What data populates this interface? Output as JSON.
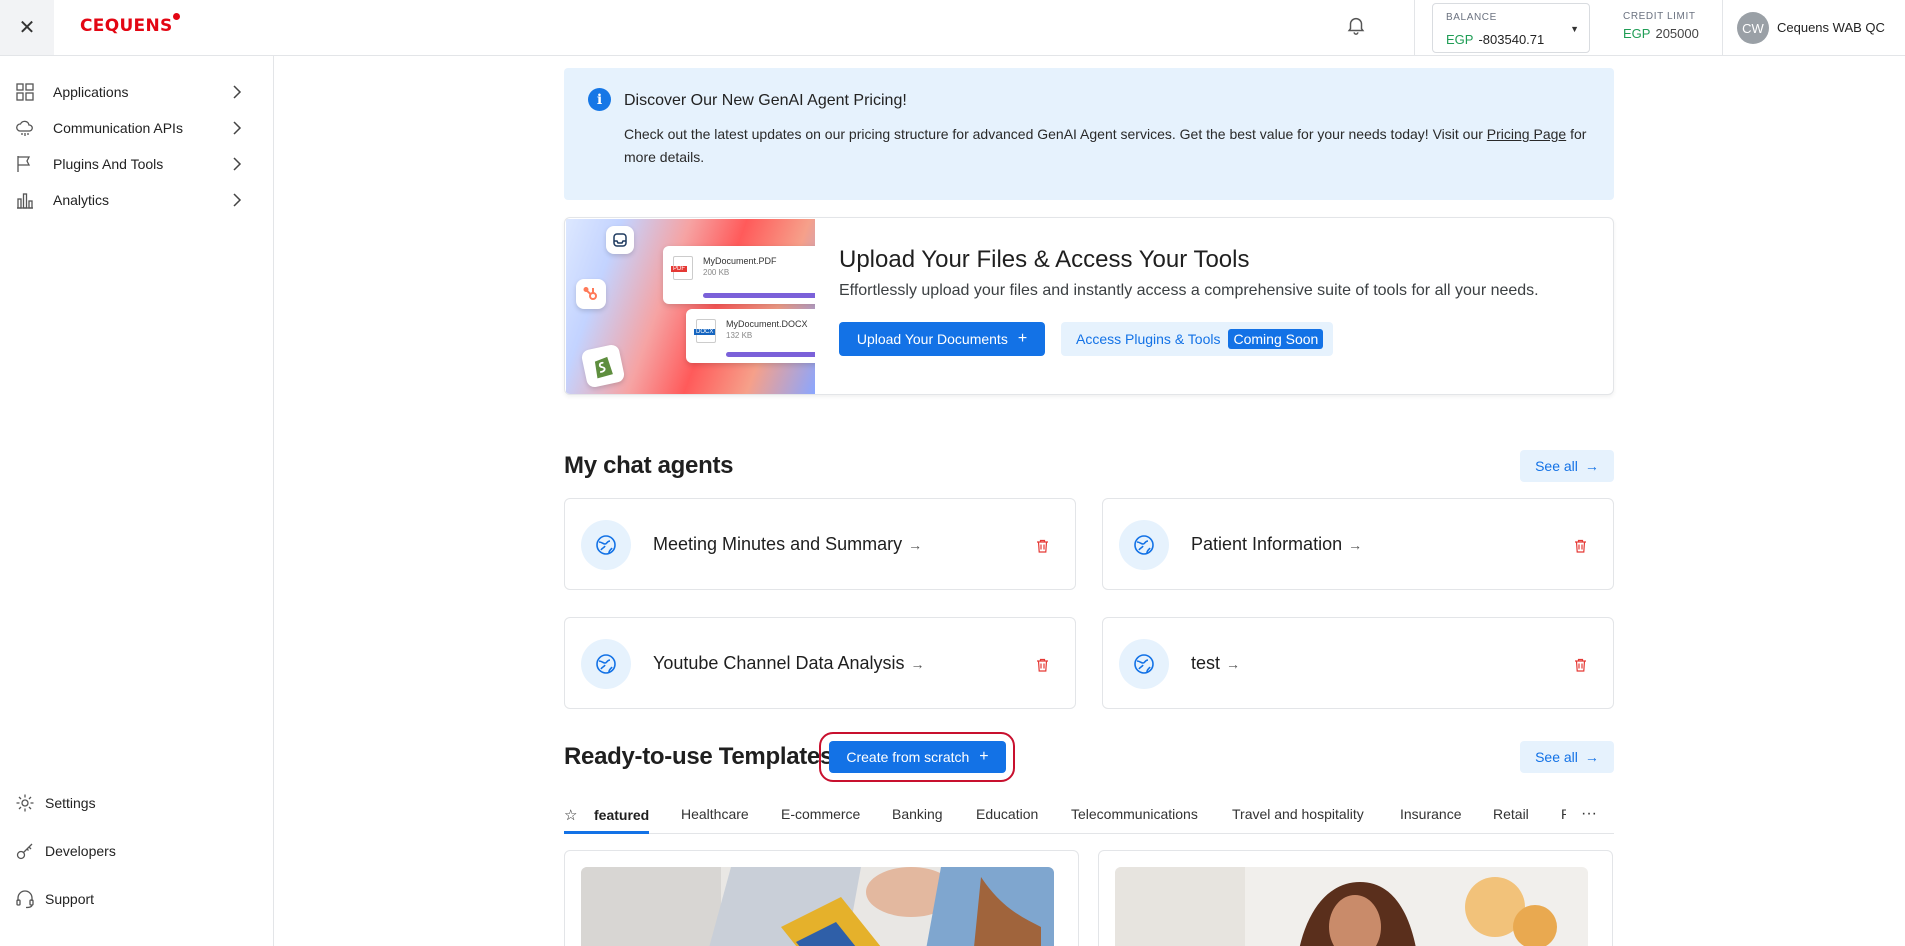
{
  "header": {
    "close_icon": "close-icon",
    "logo_text": "CEQUENS",
    "notification_icon": "bell-icon",
    "balance": {
      "label": "BALANCE",
      "currency": "EGP",
      "amount": "-803540.71"
    },
    "credit_limit": {
      "label": "CREDIT LIMIT",
      "currency": "EGP",
      "amount": "205000"
    },
    "user": {
      "initials": "CW",
      "name": "Cequens WAB QC"
    }
  },
  "sidebar": {
    "items": [
      {
        "label": "Applications",
        "icon": "grid-icon"
      },
      {
        "label": "Communication APIs",
        "icon": "cloud-icon"
      },
      {
        "label": "Plugins And Tools",
        "icon": "flag-icon"
      },
      {
        "label": "Analytics",
        "icon": "bar-chart-icon"
      }
    ],
    "bottom_items": [
      {
        "label": "Settings",
        "icon": "gear-icon"
      },
      {
        "label": "Developers",
        "icon": "key-icon"
      },
      {
        "label": "Support",
        "icon": "headset-icon"
      }
    ]
  },
  "banner": {
    "title": "Discover Our New GenAI Agent Pricing!",
    "body_prefix": "Check out the latest updates on our pricing structure for advanced GenAI Agent services. Get the best value for your needs today! Visit our ",
    "link_text": "Pricing Page",
    "body_suffix": " for more details."
  },
  "upload": {
    "title": "Upload Your Files & Access Your Tools",
    "subtitle": "Effortlessly upload your files and instantly access a comprehensive suite of tools for all your needs.",
    "upload_button": "Upload Your Documents",
    "plugins_button": "Access Plugins & Tools",
    "coming_soon": "Coming Soon",
    "art": {
      "doc1_name": "MyDocument.PDF",
      "doc1_size": "200 KB",
      "doc1_badge": "PDF",
      "doc2_name": "MyDocument.DOCX",
      "doc2_size": "132 KB",
      "doc2_badge": "DOCX"
    }
  },
  "agents": {
    "title": "My chat agents",
    "see_all": "See all",
    "items": [
      {
        "name": "Meeting Minutes and Summary"
      },
      {
        "name": "Patient Information"
      },
      {
        "name": "Youtube Channel Data Analysis"
      },
      {
        "name": "test"
      }
    ]
  },
  "templates": {
    "title": "Ready-to-use Templates",
    "create_button": "Create from scratch",
    "see_all": "See all",
    "tabs": [
      "featured",
      "Healthcare",
      "E-commerce",
      "Banking",
      "Education",
      "Telecommunications",
      "Travel and hospitality",
      "Insurance",
      "Retail",
      "R"
    ],
    "more": "···"
  },
  "colors": {
    "primary": "#1372e6",
    "brand_red": "#e30613",
    "currency_green": "#1f9d55",
    "highlight_ring": "#c8102e"
  }
}
